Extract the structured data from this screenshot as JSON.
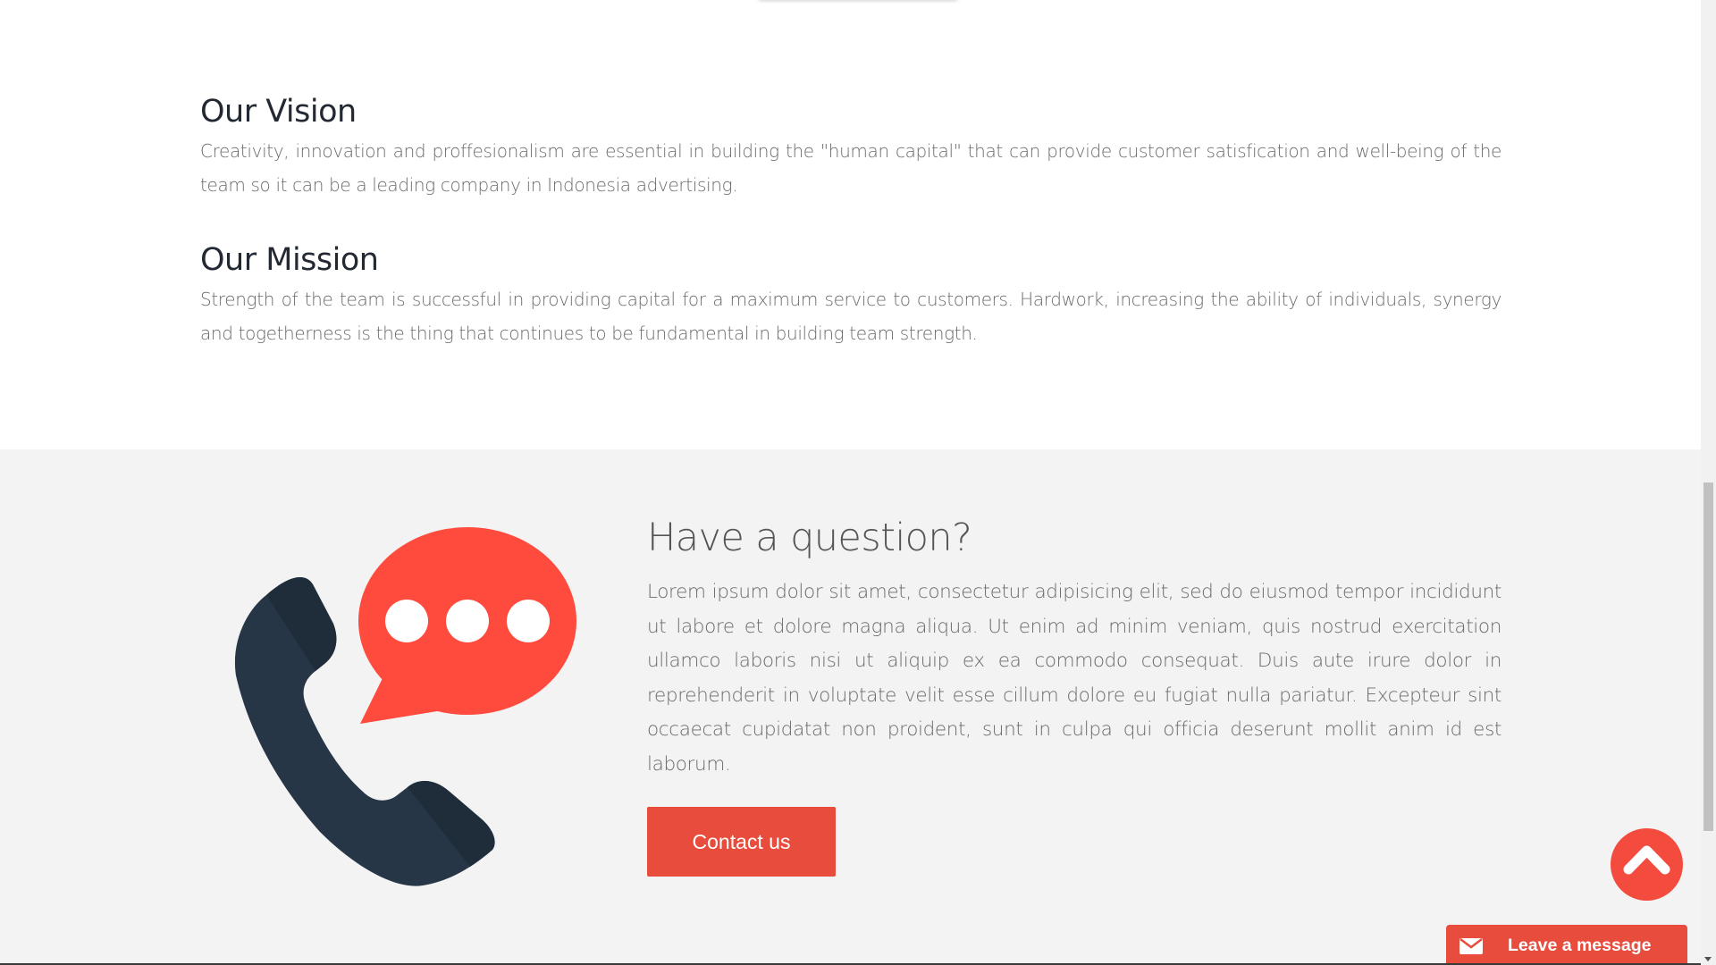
{
  "vision": {
    "heading": "Our Vision",
    "text": "Creativity, innovation and proffesionalism are essential in building the \"human capital\" that can provide customer satisfication and well-being of the team so it can be a leading company in Indonesia advertising."
  },
  "mission": {
    "heading": "Our Mission",
    "text": "Strength of the team is successful in providing capital for a maximum service to customers. Hardwork, increasing the ability of individuals, synergy and togetherness is the thing that continues to be fundamental in building team strength."
  },
  "question": {
    "heading": "Have a question?",
    "text": "Lorem ipsum dolor sit amet, consectetur adipisicing elit, sed do eiusmod tempor incididunt ut labore et dolore magna aliqua. Ut enim ad minim veniam, quis nostrud exercitation ullamco laboris nisi ut aliquip ex ea commodo consequat. Duis aute irure dolor in reprehenderit in voluptate velit esse cillum dolore eu fugiat nulla pariatur. Excepteur sint occaecat cupidatat non proident, sunt in culpa qui officia deserunt mollit anim id est laborum.",
    "button_label": "Contact us"
  },
  "widgets": {
    "scroll_top_icon": "chevron-up-icon",
    "leave_message_label": "Leave a message",
    "leave_message_icon": "envelope-icon"
  },
  "colors": {
    "accent": "#e74c3c",
    "speech_bubble": "#ff4b3e",
    "phone": "#263646",
    "heading": "#222933",
    "body_text": "#6b6b6b",
    "band_background": "#f3f3f3"
  }
}
